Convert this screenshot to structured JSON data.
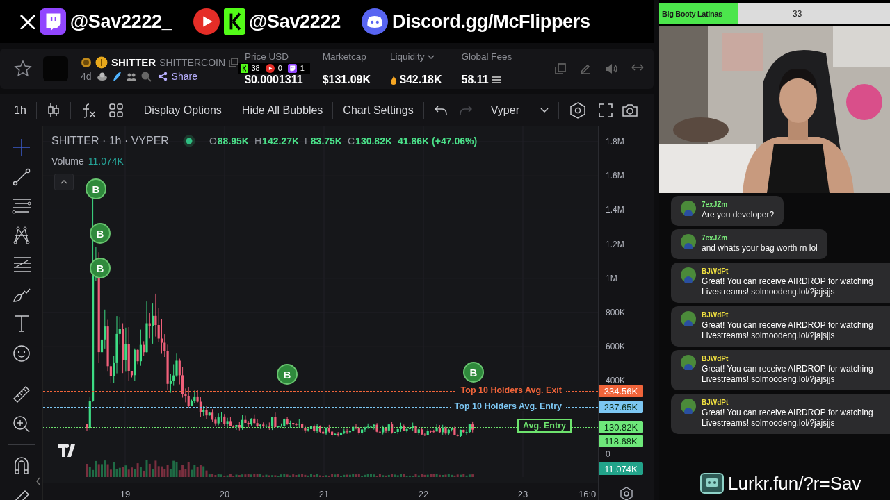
{
  "banner": [
    {
      "logos": [
        {
          "kind": "x"
        },
        {
          "kind": "twitch"
        }
      ],
      "handle": "@Sav2222_"
    },
    {
      "logos": [
        {
          "kind": "youtube"
        },
        {
          "kind": "kick"
        }
      ],
      "handle": "@Sav2222"
    },
    {
      "logos": [
        {
          "kind": "discord"
        }
      ],
      "handle": "Discord.gg/McFlippers"
    }
  ],
  "token": {
    "name": "SHITTER",
    "full_name": "SHITTERCOIN",
    "age": "4d",
    "share": "Share",
    "viewers": [
      {
        "kind": "kick",
        "count": "38"
      },
      {
        "kind": "youtube",
        "count": "0"
      },
      {
        "kind": "twitch",
        "count": "1"
      }
    ],
    "stats": [
      {
        "kind": "plain",
        "label": "Price USD",
        "value": "$0.0001311"
      },
      {
        "kind": "plain",
        "label": "Marketcap",
        "value": "$131.09K"
      },
      {
        "kind": "liquidity",
        "label": "Liquidity",
        "value": "$42.18K"
      },
      {
        "kind": "fees",
        "label": "Global Fees",
        "value": "58.11"
      }
    ]
  },
  "toolbar": {
    "interval": "1h",
    "buttons": [
      "Display Options",
      "Hide All Bubbles",
      "Chart Settings"
    ],
    "template": "Vyper"
  },
  "chart": {
    "title": "SHITTER · 1h · VYPER",
    "ohlc": [
      {
        "key": "O",
        "value": "88.95K"
      },
      {
        "key": "H",
        "value": "142.27K"
      },
      {
        "key": "L",
        "value": "83.75K"
      },
      {
        "key": "C",
        "value": "130.82K"
      }
    ],
    "change": "41.86K (+47.06%)",
    "volume": {
      "label": "Volume",
      "value": "11.074K"
    },
    "bubbles": [
      "B",
      "B",
      "B",
      "B",
      "B"
    ],
    "y_ticks": [
      "1.8M",
      "1.6M",
      "1.4M",
      "1.2M",
      "1M",
      "800K",
      "600K",
      "400K",
      "0"
    ],
    "x_ticks": [
      "19",
      "20",
      "21",
      "22",
      "23",
      "16:0"
    ],
    "lines": [
      {
        "kind": "dashed",
        "label": "Top 10 Holders Avg. Exit",
        "color": "#f0643a"
      },
      {
        "kind": "dashed",
        "label": "Top 10 Holders Avg. Entry",
        "color": "#7cc6f2"
      },
      {
        "kind": "boxed",
        "label": "Avg. Entry",
        "color": "#6ee36e"
      }
    ],
    "tags": [
      {
        "text": "334.56K",
        "color": "#f0643a"
      },
      {
        "text": "237.65K",
        "color": "#7cc6f2"
      },
      {
        "text": "130.82K",
        "color": "#6ee87a"
      },
      {
        "text": "118.68K",
        "color": "#6ee87a"
      },
      {
        "text": "11.074K",
        "color": "#22a38a"
      }
    ]
  },
  "side": {
    "poll": {
      "label": "Big Booty Latinas",
      "count": "33"
    },
    "chat": [
      {
        "user": "7exJZm",
        "color": "#7df07d",
        "text": "Are you developer?"
      },
      {
        "user": "7exJZm",
        "color": "#7df07d",
        "text": "and whats your bag worth rn lol"
      },
      {
        "user": "BJWdPt",
        "color": "#f0e040",
        "text": "Great! You can receive AIRDROP for watching Livestreams! solmoodeng.lol/?jajsjjs"
      },
      {
        "user": "BJWdPt",
        "color": "#f0e040",
        "text": "Great! You can receive AIRDROP for watching Livestreams! solmoodeng.lol/?jajsjjs"
      },
      {
        "user": "BJWdPt",
        "color": "#f0e040",
        "text": "Great! You can receive AIRDROP for watching Livestreams! solmoodeng.lol/?jajsjjs"
      },
      {
        "user": "BJWdPt",
        "color": "#f0e040",
        "text": "Great! You can receive AIRDROP for watching Livestreams! solmoodeng.lol/?jajsjjs"
      }
    ],
    "referral": "Lurkr.fun/?r=Sav"
  }
}
